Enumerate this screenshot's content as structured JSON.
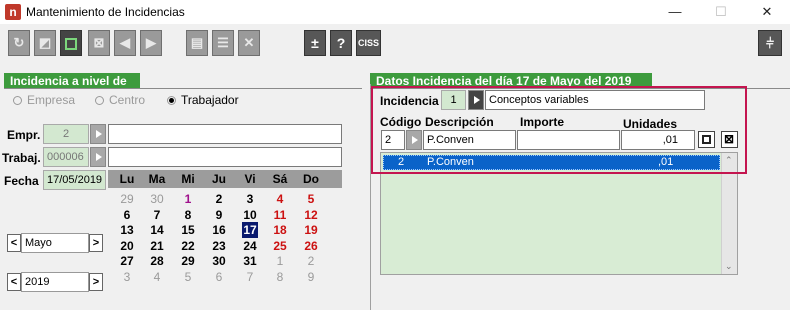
{
  "window": {
    "title": "Mantenimiento de Incidencias",
    "minimize": "—",
    "maximize": "☐",
    "close": "✕"
  },
  "toolbar": {
    "plus_minus": "±",
    "help": "?",
    "ciss": "CISS"
  },
  "left": {
    "section_title": "Incidencia a nivel de",
    "radios": [
      {
        "label": "Empresa",
        "checked": false
      },
      {
        "label": "Centro",
        "checked": false
      },
      {
        "label": "Trabajador",
        "checked": true
      }
    ],
    "empr_label": "Empr.",
    "empr_value": "2",
    "trabaj_label": "Trabaj.",
    "trabaj_value": "000006",
    "fecha_label": "Fecha",
    "fecha_value": "17/05/2019",
    "month_value": "Mayo",
    "year_value": "2019",
    "prev_label": "<",
    "next_label": ">"
  },
  "calendar": {
    "headers": [
      "Lu",
      "Ma",
      "Mi",
      "Ju",
      "Vi",
      "Sá",
      "Do"
    ],
    "weeks": [
      [
        {
          "d": "29",
          "t": "other"
        },
        {
          "d": "30",
          "t": "other"
        },
        {
          "d": "1",
          "t": "hol"
        },
        {
          "d": "2",
          "t": ""
        },
        {
          "d": "3",
          "t": ""
        },
        {
          "d": "4",
          "t": "sun"
        },
        {
          "d": "5",
          "t": "sun"
        }
      ],
      [
        {
          "d": "6",
          "t": ""
        },
        {
          "d": "7",
          "t": ""
        },
        {
          "d": "8",
          "t": ""
        },
        {
          "d": "9",
          "t": ""
        },
        {
          "d": "10",
          "t": ""
        },
        {
          "d": "11",
          "t": "sun"
        },
        {
          "d": "12",
          "t": "sun"
        }
      ],
      [
        {
          "d": "13",
          "t": ""
        },
        {
          "d": "14",
          "t": ""
        },
        {
          "d": "15",
          "t": ""
        },
        {
          "d": "16",
          "t": ""
        },
        {
          "d": "17",
          "t": "sel"
        },
        {
          "d": "18",
          "t": "sun"
        },
        {
          "d": "19",
          "t": "sun"
        }
      ],
      [
        {
          "d": "20",
          "t": ""
        },
        {
          "d": "21",
          "t": ""
        },
        {
          "d": "22",
          "t": ""
        },
        {
          "d": "23",
          "t": ""
        },
        {
          "d": "24",
          "t": ""
        },
        {
          "d": "25",
          "t": "sun"
        },
        {
          "d": "26",
          "t": "sun"
        }
      ],
      [
        {
          "d": "27",
          "t": ""
        },
        {
          "d": "28",
          "t": ""
        },
        {
          "d": "29",
          "t": ""
        },
        {
          "d": "30",
          "t": ""
        },
        {
          "d": "31",
          "t": ""
        },
        {
          "d": "1",
          "t": "other"
        },
        {
          "d": "2",
          "t": "other"
        }
      ],
      [
        {
          "d": "3",
          "t": "other"
        },
        {
          "d": "4",
          "t": "other"
        },
        {
          "d": "5",
          "t": "other"
        },
        {
          "d": "6",
          "t": "other"
        },
        {
          "d": "7",
          "t": "other"
        },
        {
          "d": "8",
          "t": "other"
        },
        {
          "d": "9",
          "t": "other"
        }
      ]
    ]
  },
  "right": {
    "section_title": "Datos Incidencia del día 17 de Mayo del 2019",
    "incidencia_label": "Incidencia",
    "incidencia_value": "1",
    "incidencia_desc": "Conceptos variables",
    "col_codigo": "Código",
    "col_descripcion": "Descripción",
    "col_importe": "Importe",
    "col_unidades": "Unidades",
    "edit_codigo": "2",
    "edit_descripcion": "P.Conven",
    "edit_importe": "",
    "edit_unidades": ",01",
    "row_codigo": "2",
    "row_descripcion": "P.Conven",
    "row_unidades": ",01"
  },
  "colors": {
    "section_green": "#3d9b3d",
    "field_green": "#d3e8d0",
    "selection_blue": "#0a63c9",
    "highlight_pink": "#c4154f"
  }
}
